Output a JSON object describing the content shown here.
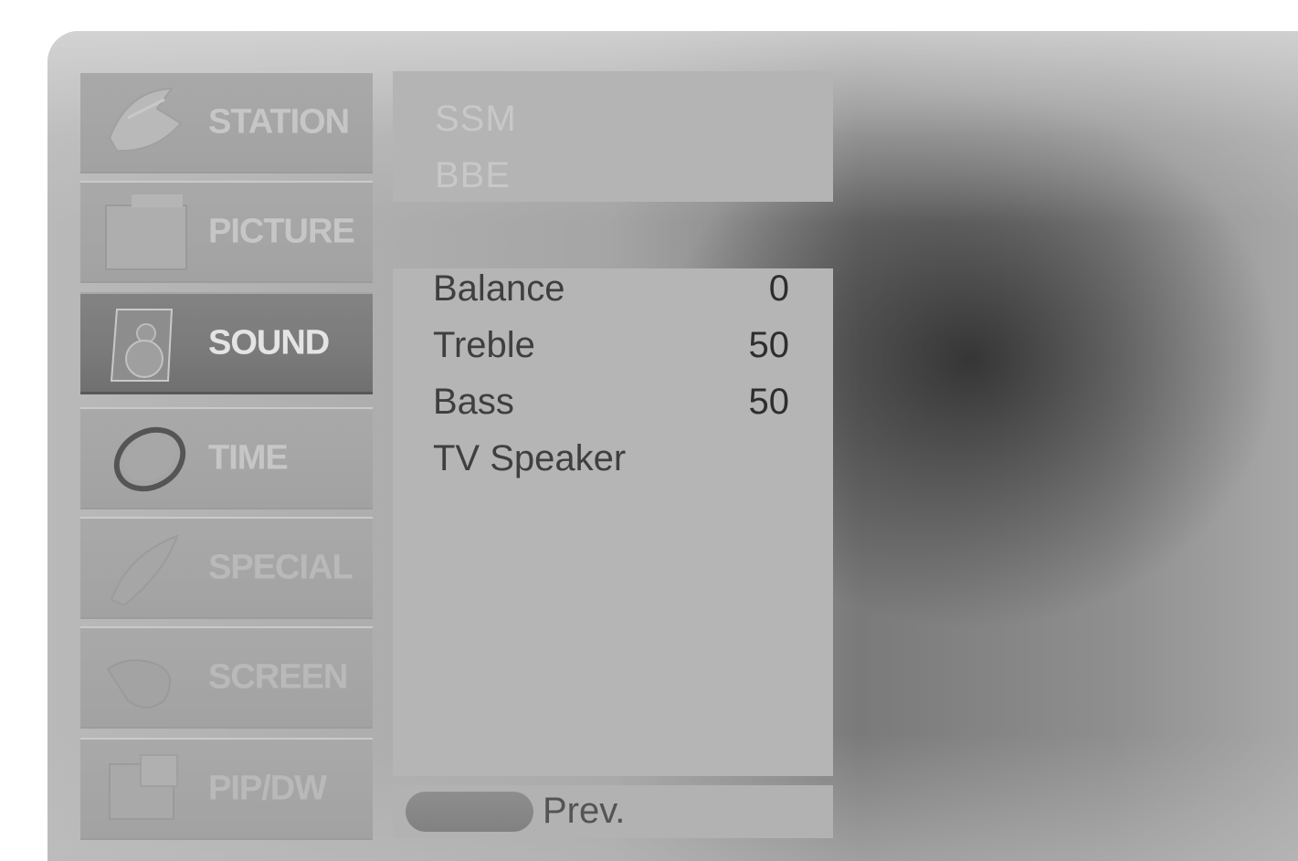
{
  "menu": {
    "items": [
      {
        "label": "STATION",
        "icon": "satellite-dish-icon",
        "state": "normal"
      },
      {
        "label": "PICTURE",
        "icon": "picture-frame-icon",
        "state": "normal"
      },
      {
        "label": "SOUND",
        "icon": "speaker-icon",
        "state": "selected"
      },
      {
        "label": "TIME",
        "icon": "clock-ring-icon",
        "state": "normal"
      },
      {
        "label": "SPECIAL",
        "icon": "special-feather-icon",
        "state": "faded"
      },
      {
        "label": "SCREEN",
        "icon": "screen-hand-icon",
        "state": "faded"
      },
      {
        "label": "PIP/DW",
        "icon": "pip-window-icon",
        "state": "faded"
      }
    ]
  },
  "sound_submenu_top": {
    "items": [
      "SSM",
      "BBE"
    ]
  },
  "sound_submenu": {
    "rows": [
      {
        "label": "Balance",
        "value": "0"
      },
      {
        "label": "Treble",
        "value": "50"
      },
      {
        "label": "Bass",
        "value": "50"
      },
      {
        "label": "TV Speaker",
        "value": ""
      }
    ]
  },
  "footer": {
    "prev_label": "Prev."
  },
  "colors": {
    "panel": "#b5b5b5",
    "selected": "#7a7a7a",
    "text_dark": "#3f3f3f"
  }
}
